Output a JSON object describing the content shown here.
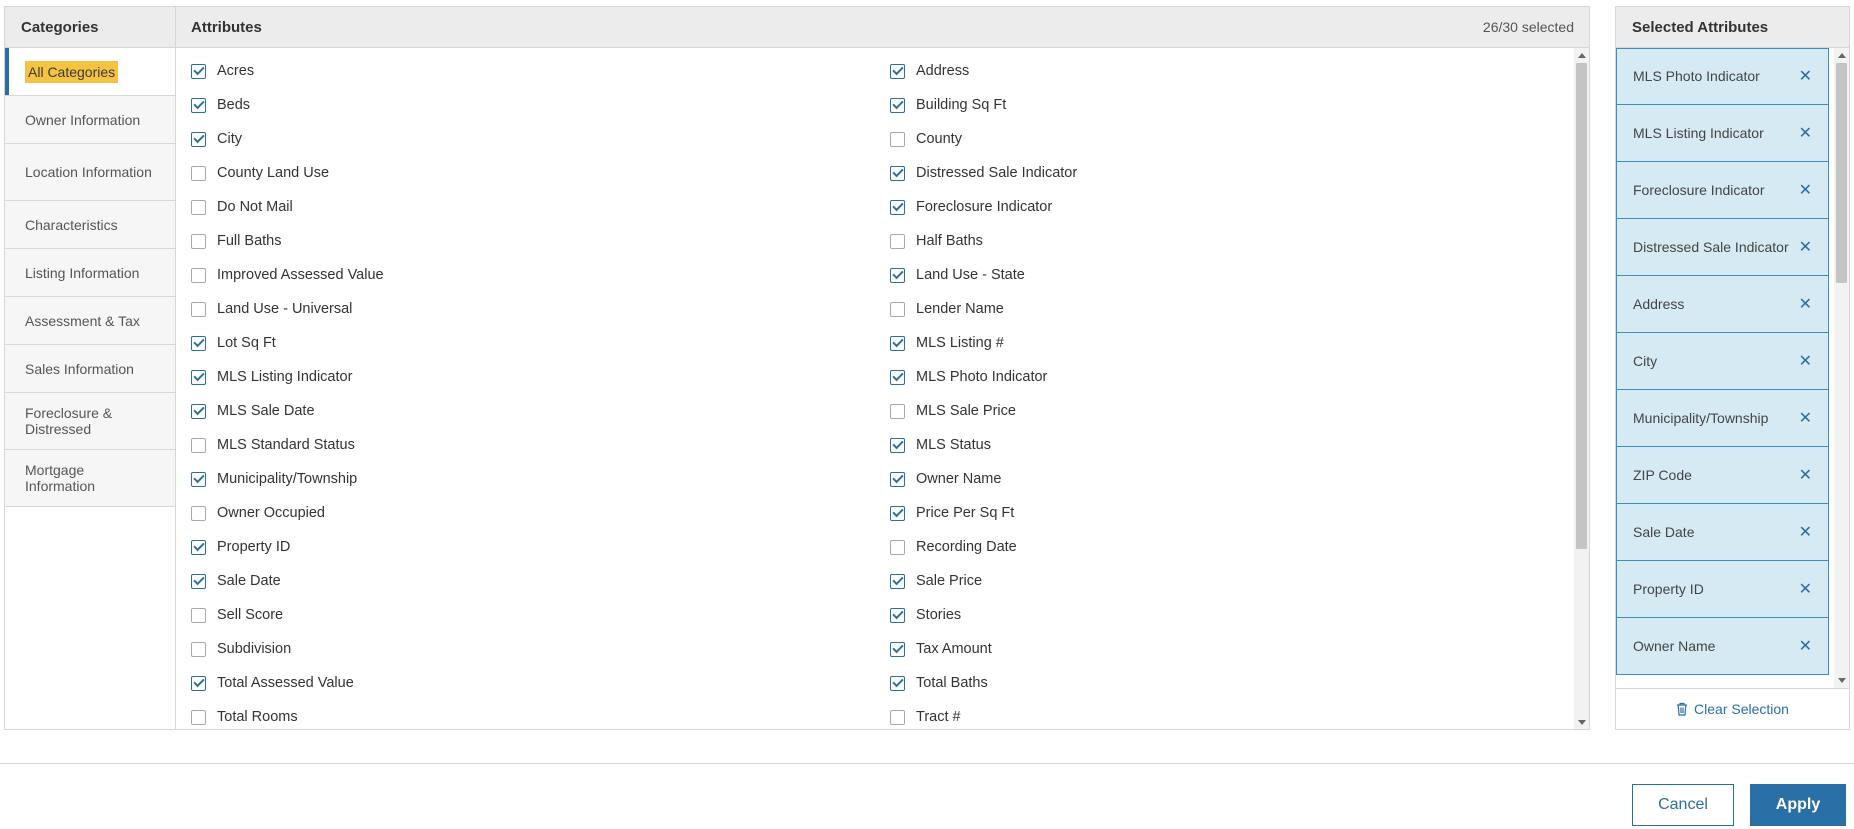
{
  "categories": {
    "header": "Categories",
    "items": [
      {
        "label": "All Categories",
        "active": true
      },
      {
        "label": "Owner Information"
      },
      {
        "label": "Location Information"
      },
      {
        "label": "Characteristics"
      },
      {
        "label": "Listing Information"
      },
      {
        "label": "Assessment & Tax"
      },
      {
        "label": "Sales Information"
      },
      {
        "label": "Foreclosure & Distressed"
      },
      {
        "label": "Mortgage Information"
      }
    ]
  },
  "attributes": {
    "header": "Attributes",
    "count": "26/30 selected",
    "left": [
      {
        "label": "Acres",
        "checked": true
      },
      {
        "label": "Beds",
        "checked": true
      },
      {
        "label": "City",
        "checked": true
      },
      {
        "label": "County Land Use",
        "checked": false
      },
      {
        "label": "Do Not Mail",
        "checked": false
      },
      {
        "label": "Full Baths",
        "checked": false
      },
      {
        "label": "Improved Assessed Value",
        "checked": false
      },
      {
        "label": "Land Use - Universal",
        "checked": false
      },
      {
        "label": "Lot Sq Ft",
        "checked": true
      },
      {
        "label": "MLS Listing Indicator",
        "checked": true
      },
      {
        "label": "MLS Sale Date",
        "checked": true
      },
      {
        "label": "MLS Standard Status",
        "checked": false
      },
      {
        "label": "Municipality/Township",
        "checked": true
      },
      {
        "label": "Owner Occupied",
        "checked": false
      },
      {
        "label": "Property ID",
        "checked": true
      },
      {
        "label": "Sale Date",
        "checked": true
      },
      {
        "label": "Sell Score",
        "checked": false
      },
      {
        "label": "Subdivision",
        "checked": false
      },
      {
        "label": "Total Assessed Value",
        "checked": true
      },
      {
        "label": "Total Rooms",
        "checked": false
      }
    ],
    "right": [
      {
        "label": "Address",
        "checked": true
      },
      {
        "label": "Building Sq Ft",
        "checked": true
      },
      {
        "label": "County",
        "checked": false
      },
      {
        "label": "Distressed Sale Indicator",
        "checked": true
      },
      {
        "label": "Foreclosure Indicator",
        "checked": true
      },
      {
        "label": "Half Baths",
        "checked": false
      },
      {
        "label": "Land Use - State",
        "checked": true
      },
      {
        "label": "Lender Name",
        "checked": false
      },
      {
        "label": "MLS Listing #",
        "checked": true
      },
      {
        "label": "MLS Photo Indicator",
        "checked": true
      },
      {
        "label": "MLS Sale Price",
        "checked": false
      },
      {
        "label": "MLS Status",
        "checked": true
      },
      {
        "label": "Owner Name",
        "checked": true
      },
      {
        "label": "Price Per Sq Ft",
        "checked": true
      },
      {
        "label": "Recording Date",
        "checked": false
      },
      {
        "label": "Sale Price",
        "checked": true
      },
      {
        "label": "Stories",
        "checked": true
      },
      {
        "label": "Tax Amount",
        "checked": true
      },
      {
        "label": "Total Baths",
        "checked": true
      },
      {
        "label": "Tract #",
        "checked": false
      }
    ]
  },
  "selected": {
    "header": "Selected Attributes",
    "items": [
      "MLS Photo Indicator",
      "MLS Listing Indicator",
      "Foreclosure Indicator",
      "Distressed Sale Indicator",
      "Address",
      "City",
      "Municipality/Township",
      "ZIP Code",
      "Sale Date",
      "Property ID",
      "Owner Name"
    ],
    "remove_glyph": "✕",
    "clear_label": "Clear Selection"
  },
  "buttons": {
    "cancel": "Cancel",
    "apply": "Apply"
  },
  "colors": {
    "accent": "#2a6ea6",
    "highlight": "#f5c242",
    "selected_bg": "#d6eaf4",
    "header_bg": "#ececec"
  }
}
